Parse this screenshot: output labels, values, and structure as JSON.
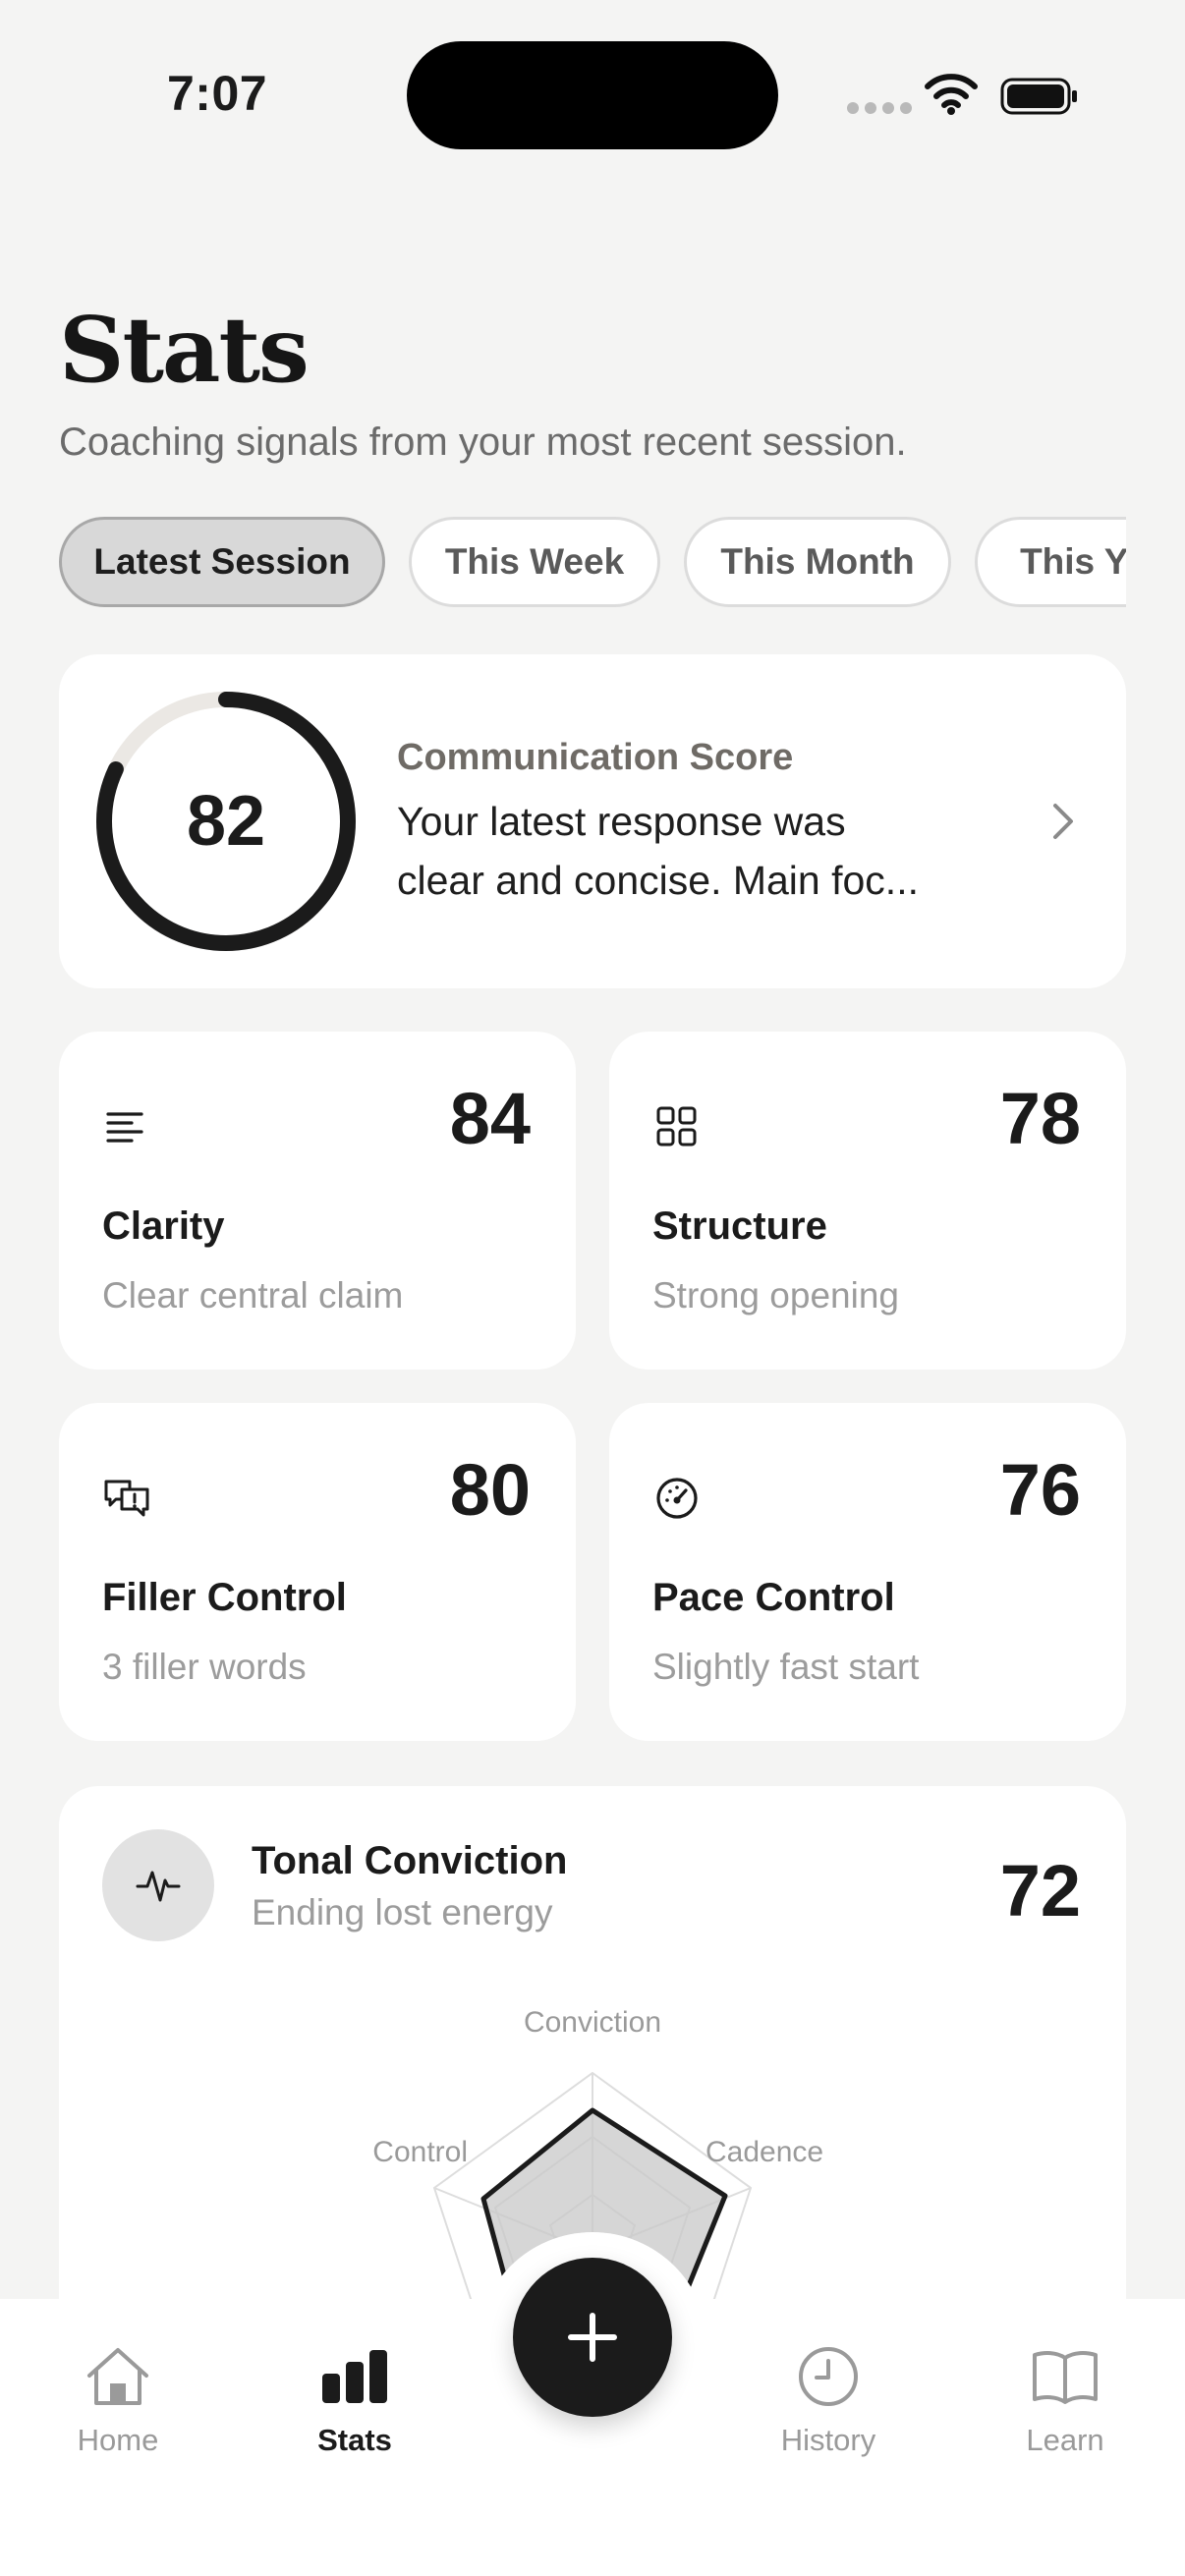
{
  "status_bar": {
    "time": "7:07"
  },
  "header": {
    "title": "Stats",
    "subtitle": "Coaching signals from your most recent session."
  },
  "tabs": [
    {
      "label": "Latest Session",
      "active": true
    },
    {
      "label": "This Week",
      "active": false
    },
    {
      "label": "This Month",
      "active": false
    },
    {
      "label": "This Year",
      "active": false
    }
  ],
  "score_card": {
    "value": "82",
    "progress": 0.82,
    "label": "Communication Score",
    "description_line1": "Your latest response was",
    "description_line2": "clear and concise. Main foc..."
  },
  "metrics": [
    {
      "icon": "lines-icon",
      "value": "84",
      "title": "Clarity",
      "subtitle": "Clear central claim"
    },
    {
      "icon": "grid-icon",
      "value": "78",
      "title": "Structure",
      "subtitle": "Strong opening"
    },
    {
      "icon": "speech-bubbles-alert-icon",
      "value": "80",
      "title": "Filler Control",
      "subtitle": "3 filler words"
    },
    {
      "icon": "speedometer-icon",
      "value": "76",
      "title": "Pace Control",
      "subtitle": "Slightly fast start"
    }
  ],
  "tonal": {
    "icon": "waveform-icon",
    "title": "Tonal Conviction",
    "subtitle": "Ending lost energy",
    "value": "72",
    "radar_labels": {
      "top": "Conviction",
      "right": "Cadence",
      "left": "Control"
    }
  },
  "nav": {
    "items": [
      {
        "label": "Home",
        "icon": "home-icon",
        "active": false
      },
      {
        "label": "Stats",
        "icon": "bar-chart-icon",
        "active": true
      },
      {
        "label": "History",
        "icon": "clock-icon",
        "active": false
      },
      {
        "label": "Learn",
        "icon": "book-icon",
        "active": false
      }
    ],
    "fab_icon": "plus-icon"
  },
  "colors": {
    "background": "#f4f4f3",
    "card": "#ffffff",
    "accent": "#1b1b1b",
    "muted_text": "#9c9c9c"
  }
}
